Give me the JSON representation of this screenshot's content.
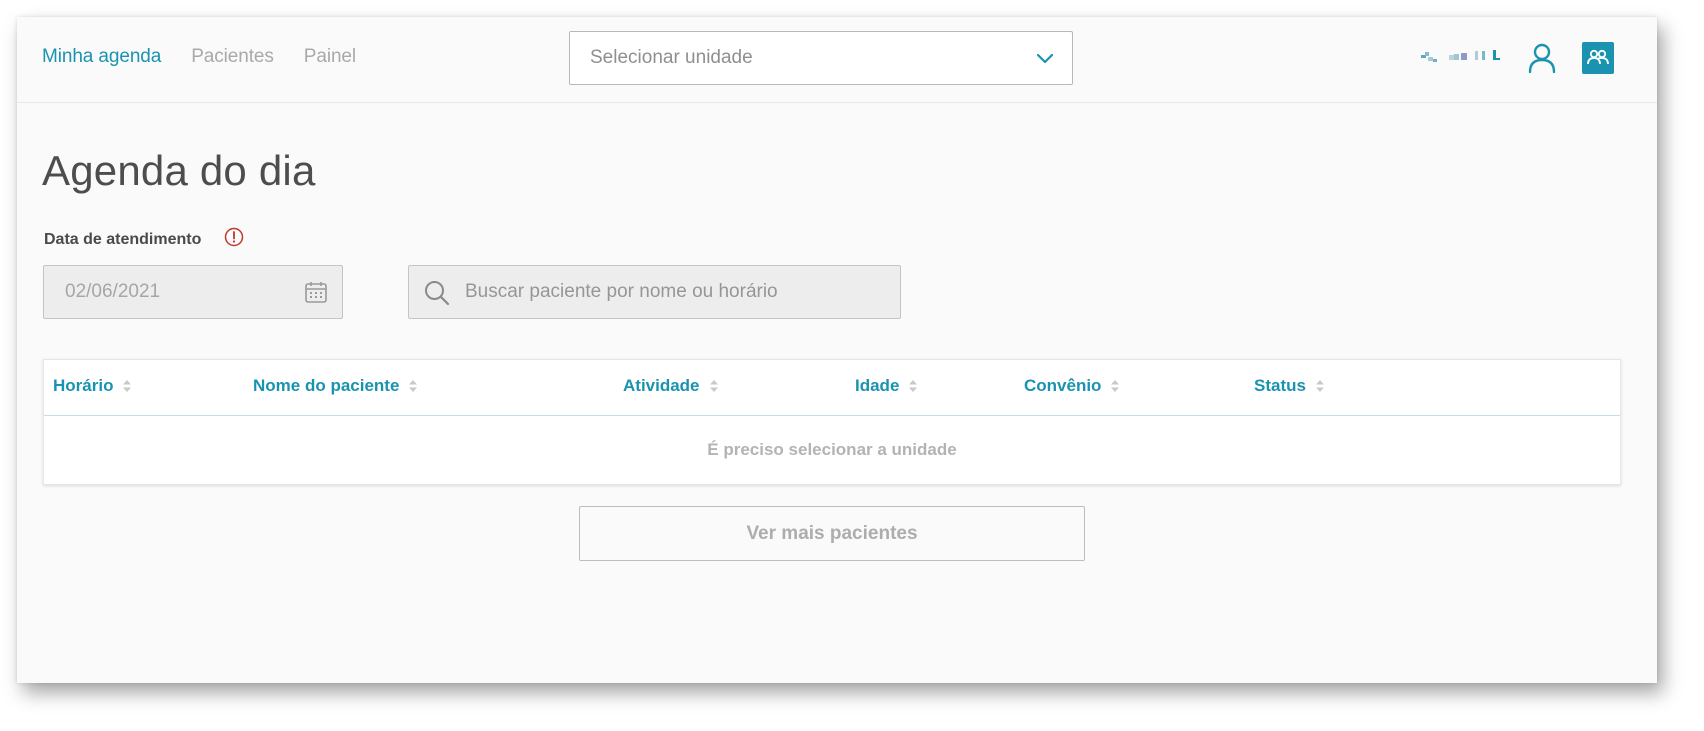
{
  "nav": {
    "items": [
      {
        "label": "Minha agenda",
        "active": true
      },
      {
        "label": "Pacientes",
        "active": false
      },
      {
        "label": "Painel",
        "active": false
      }
    ]
  },
  "unit_select": {
    "placeholder": "Selecionar unidade",
    "icon": "chevron-down-icon"
  },
  "header_icons": [
    "user-icon",
    "team-icon"
  ],
  "page": {
    "title": "Agenda do dia"
  },
  "date_field": {
    "label": "Data de atendimento",
    "value": "02/06/2021",
    "icon": "calendar-icon",
    "alert_icon": "info-alert-icon"
  },
  "search": {
    "placeholder": "Buscar paciente por nome ou horário",
    "icon": "search-icon"
  },
  "table": {
    "columns": [
      "Horário",
      "Nome do paciente",
      "Atividade",
      "Idade",
      "Convênio",
      "Status"
    ],
    "empty_message": "É preciso selecionar a unidade"
  },
  "more_button": {
    "label": "Ver mais pacientes"
  },
  "colors": {
    "accent": "#1a93b0",
    "alert": "#c0392b",
    "muted_text": "#a9a9a9",
    "background": "#fafafa"
  }
}
